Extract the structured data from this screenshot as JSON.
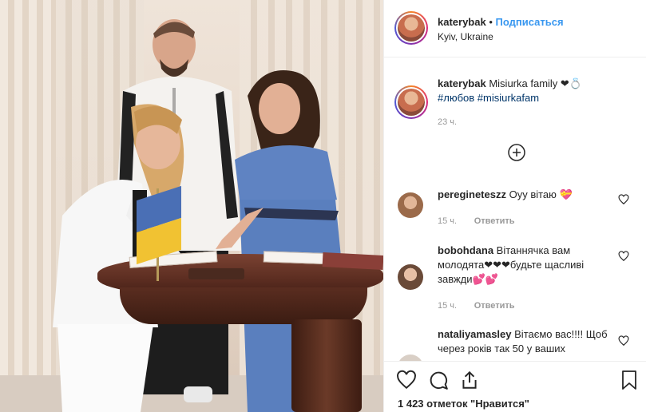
{
  "post": {
    "author": "katerybak",
    "follow_label": "Подписаться",
    "separator": "•",
    "location": "Kyiv, Ukraine"
  },
  "caption": {
    "username": "katerybak",
    "text": "Misiurka family ❤💍",
    "hashtag1": "#любов",
    "hashtag2": "#misiurkafam",
    "time": "23 ч."
  },
  "comments": [
    {
      "username": "peregineteszz",
      "text": "Оуу вітаю 💝",
      "time": "15 ч.",
      "reply": "Ответить"
    },
    {
      "username": "bobohdana",
      "text": "Вітаннячка вам молодята❤❤❤будьте щасливі завжди💕💕",
      "time": "15 ч.",
      "reply": "Ответить"
    },
    {
      "username": "nataliyamasley",
      "text": "Вітаємо вас!!!! Щоб через років так 50 у ваших",
      "time": "",
      "reply": ""
    }
  ],
  "footer": {
    "likes": "1 423 отметок \"Нравится\""
  },
  "icons": {
    "like": "heart-icon",
    "comment": "comment-icon",
    "share": "share-icon",
    "save": "bookmark-icon",
    "load_more": "plus-circle-icon"
  },
  "colors": {
    "link_blue": "#3897f0",
    "hashtag": "#003569",
    "muted": "#999999",
    "border": "#efefef"
  }
}
